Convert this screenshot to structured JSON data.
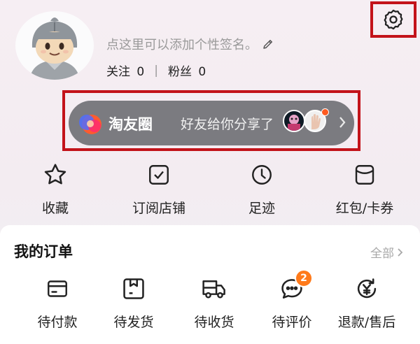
{
  "profile": {
    "signature": "点这里可以添加个性签名。",
    "following_label": "关注",
    "following_count": "0",
    "fans_label": "粉丝",
    "fans_count": "0",
    "separator": "|"
  },
  "circle_banner": {
    "title": "淘友圈",
    "share_text": "好友给你分享了"
  },
  "shortcuts": [
    {
      "label": "收藏",
      "icon": "star-icon"
    },
    {
      "label": "订阅店铺",
      "icon": "subscribe-store-icon"
    },
    {
      "label": "足迹",
      "icon": "clock-icon"
    },
    {
      "label": "红包/卡券",
      "icon": "coupon-icon"
    }
  ],
  "orders": {
    "title": "我的订单",
    "view_all": "全部",
    "items": [
      {
        "label": "待付款",
        "icon": "wallet-card-icon"
      },
      {
        "label": "待发货",
        "icon": "package-box-icon"
      },
      {
        "label": "待收货",
        "icon": "truck-icon"
      },
      {
        "label": "待评价",
        "icon": "chat-bubble-icon",
        "badge": "2"
      },
      {
        "label": "退款/售后",
        "icon": "refund-yen-icon"
      }
    ]
  },
  "colors": {
    "highlight_border": "#c3131a",
    "banner_bg": "#7b7b80",
    "badge": "#ff7a1a"
  }
}
